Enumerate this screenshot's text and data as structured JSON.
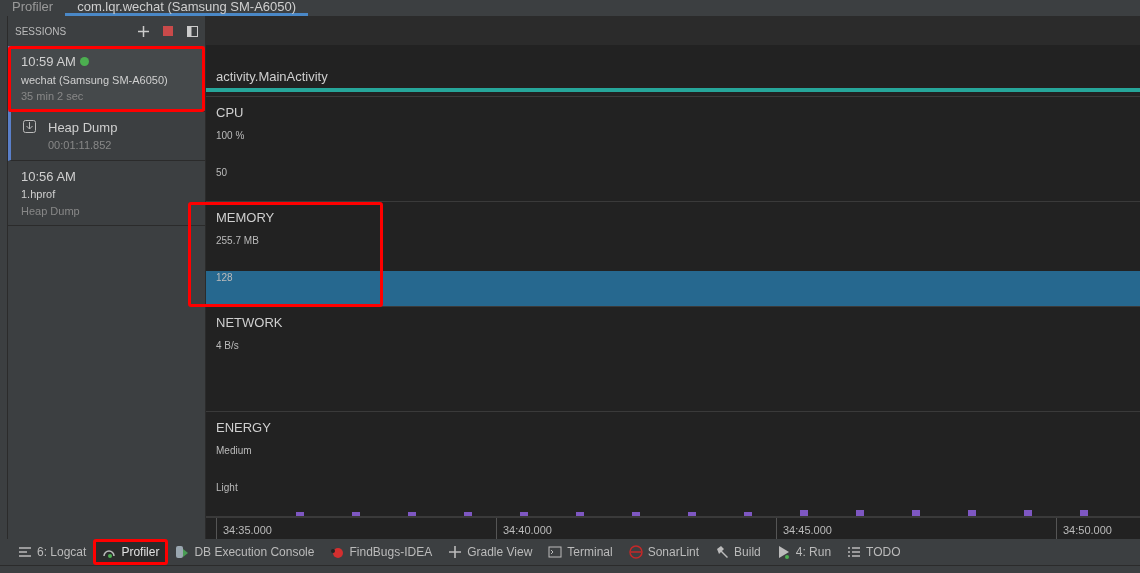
{
  "tabs": [
    {
      "label": "Profiler",
      "selected": false
    },
    {
      "label": "com.lqr.wechat (Samsung SM-A6050)",
      "selected": true
    }
  ],
  "sessions": {
    "title": "SESSIONS",
    "items": [
      {
        "kind": "session",
        "time": "10:59 AM",
        "name": "wechat (Samsung SM-A6050)",
        "detail": "35 min 2 sec",
        "live": true,
        "selected": true,
        "highlighted": true
      },
      {
        "kind": "artifact",
        "title": "Heap Dump",
        "detail": "00:01:11.852",
        "selected": false,
        "highlighted": false
      },
      {
        "kind": "session",
        "time": "10:56 AM",
        "name": "1.hprof",
        "detail": "Heap Dump",
        "live": false,
        "selected": false,
        "highlighted": false
      }
    ]
  },
  "activity": "activity.MainActivity",
  "monitors": [
    {
      "kind": "cpu",
      "title": "CPU",
      "ticks": [
        "100 %",
        "50"
      ],
      "highlighted": false
    },
    {
      "kind": "memory",
      "title": "MEMORY",
      "ticks": [
        "255.7 MB",
        "128"
      ],
      "highlighted": true
    },
    {
      "kind": "network",
      "title": "NETWORK",
      "ticks": [
        "4 B/s"
      ],
      "highlighted": false
    },
    {
      "kind": "energy",
      "title": "ENERGY",
      "ticks": [
        "Medium",
        "Light"
      ],
      "highlighted": false
    }
  ],
  "timeline": [
    "34:35.000",
    "34:40.000",
    "34:45.000",
    "34:50.000"
  ],
  "tool_windows": [
    {
      "kind": "logcat",
      "label": "6: Logcat",
      "selected": false,
      "highlighted": false
    },
    {
      "kind": "profiler",
      "label": "Profiler",
      "selected": true,
      "highlighted": true
    },
    {
      "kind": "db",
      "label": "DB Execution Console",
      "selected": false,
      "highlighted": false
    },
    {
      "kind": "bug",
      "label": "FindBugs-IDEA",
      "selected": false,
      "highlighted": false
    },
    {
      "kind": "plus",
      "label": "Gradle View",
      "selected": false,
      "highlighted": false
    },
    {
      "kind": "terminal",
      "label": "Terminal",
      "selected": false,
      "highlighted": false
    },
    {
      "kind": "sonar",
      "label": "SonarLint",
      "selected": false,
      "highlighted": false
    },
    {
      "kind": "build",
      "label": "Build",
      "selected": false,
      "highlighted": false
    },
    {
      "kind": "run",
      "label": "4: Run",
      "selected": false,
      "highlighted": false
    },
    {
      "kind": "todo",
      "label": "TODO",
      "selected": false,
      "highlighted": false
    }
  ]
}
